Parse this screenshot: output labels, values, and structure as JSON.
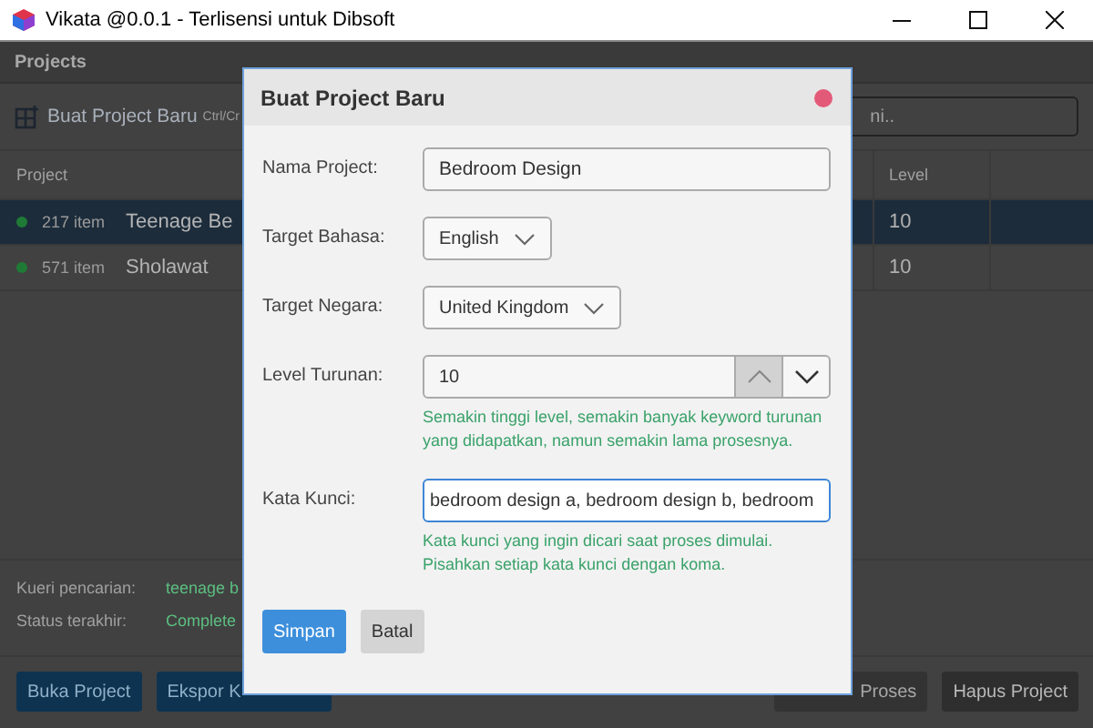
{
  "window": {
    "title": "Vikata @0.0.1 - Terlisensi untuk Dibsoft"
  },
  "app": {
    "section": "Projects",
    "new_project": {
      "label": "Buat Project Baru",
      "shortcut": "Ctrl/Cr"
    },
    "search": {
      "placeholder": "ni.."
    },
    "table": {
      "columns": [
        "Project",
        "Level"
      ],
      "rows": [
        {
          "count": "217 item",
          "name": "Teenage Be",
          "level_value": "10",
          "selected": true,
          "color": "#1f7a35"
        },
        {
          "count": "571 item",
          "name": "Sholawat",
          "level_value": "10",
          "selected": false,
          "color": "#1f7a35"
        }
      ]
    },
    "details": [
      {
        "label": "Kueri pencarian:",
        "value": "teenage b"
      },
      {
        "label": "Status terakhir:",
        "value": "Complete"
      }
    ],
    "buttons_left": [
      "Buka Project",
      "Ekspor K"
    ],
    "buttons_right": [
      "Proses",
      "Hapus Project"
    ]
  },
  "dialog": {
    "title": "Buat Project Baru",
    "fields": [
      {
        "kind": "text",
        "label": "Nama Project:",
        "value": "Bedroom Design",
        "focused": false
      },
      {
        "kind": "select",
        "label": "Target Bahasa:",
        "value": "English"
      },
      {
        "kind": "select",
        "label": "Target Negara:",
        "value": "United Kingdom"
      },
      {
        "kind": "spinner",
        "label": "Level Turunan:",
        "value": "10",
        "help": "Semakin tinggi level, semakin banyak keyword turunan yang didapatkan, namun semakin lama prosesnya."
      },
      {
        "kind": "text",
        "label": "Kata Kunci:",
        "value": "bedroom design a, bedroom design b, bedroom",
        "focused": true,
        "help": "Kata kunci yang ingin dicari saat proses dimulai. Pisahkan setiap kata kunci dengan koma."
      }
    ],
    "actions": [
      {
        "label": "Simpan",
        "kind": "primary"
      },
      {
        "label": "Batal",
        "kind": "secondary"
      }
    ]
  }
}
